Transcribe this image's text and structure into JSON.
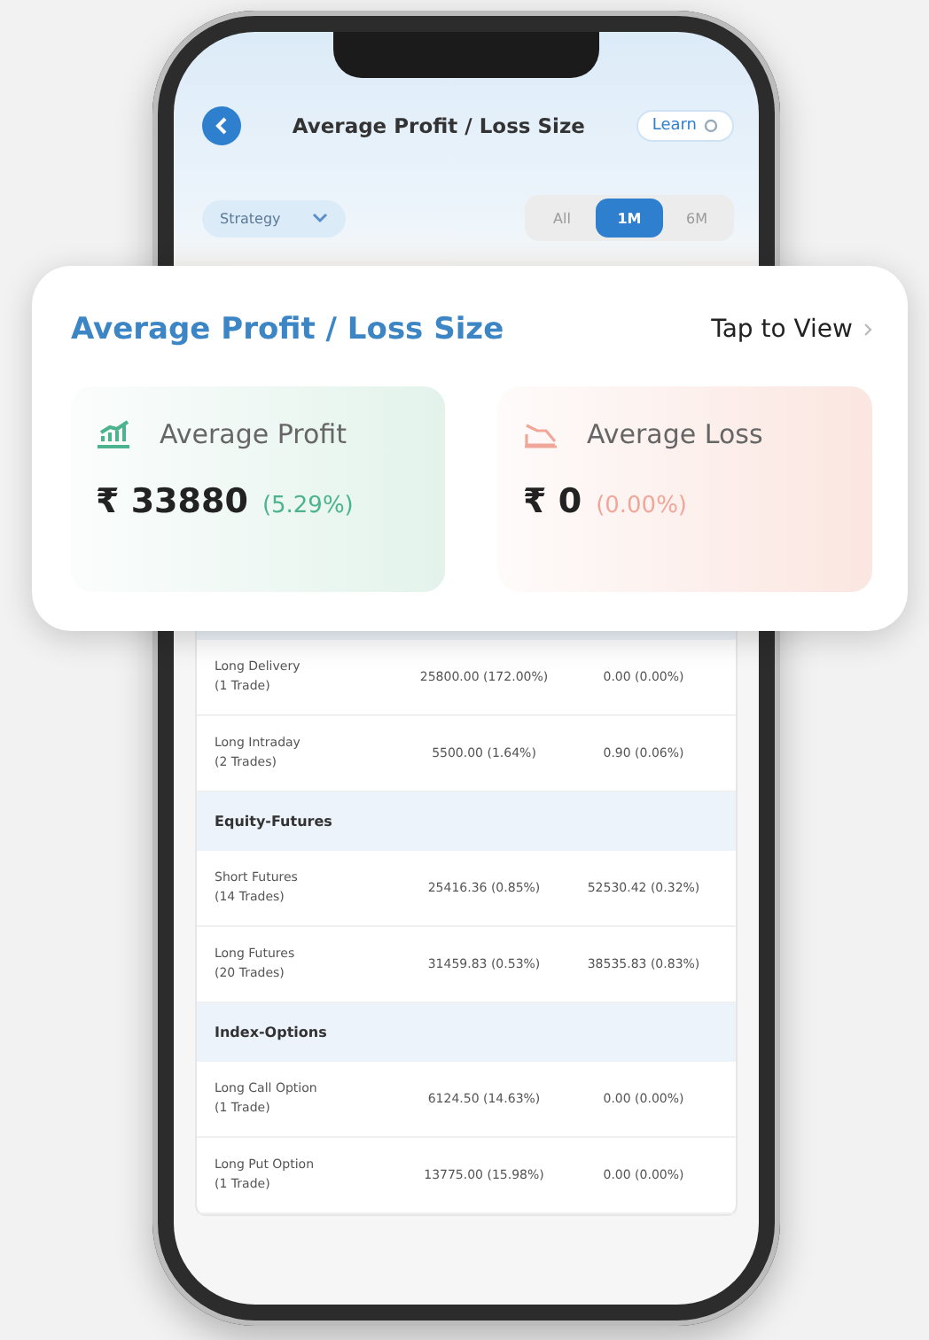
{
  "header": {
    "title": "Average Profit / Loss Size",
    "learn_button": "Learn"
  },
  "filters": {
    "dropdown": "Strategy",
    "periods": [
      {
        "label": "All",
        "selected": false
      },
      {
        "label": "1M",
        "selected": true
      },
      {
        "label": "6M",
        "selected": false
      }
    ]
  },
  "summary_card": {
    "title": "Average Profit / Loss Size",
    "link": "Tap to View",
    "tiles": [
      {
        "kind": "profit",
        "label": "Average Profit",
        "amount": "₹ 33880",
        "percent": "(5.29%)"
      },
      {
        "kind": "loss",
        "label": "Average Loss",
        "amount": "₹ 0",
        "percent": "(0.00%)"
      }
    ]
  },
  "table": {
    "sections": [
      {
        "rows": [
          {
            "name": "Long Delivery",
            "trades": "(1 Trade)",
            "profit": "25800.00 (172.00%)",
            "loss": "0.00 (0.00%)"
          },
          {
            "name": "Long Intraday",
            "trades": "(2 Trades)",
            "profit": "5500.00 (1.64%)",
            "loss": "0.90 (0.06%)"
          }
        ]
      },
      {
        "title": "Equity-Futures",
        "rows": [
          {
            "name": "Short Futures",
            "trades": "(14 Trades)",
            "profit": "25416.36 (0.85%)",
            "loss": "52530.42 (0.32%)"
          },
          {
            "name": "Long Futures",
            "trades": "(20 Trades)",
            "profit": "31459.83 (0.53%)",
            "loss": "38535.83 (0.83%)"
          }
        ]
      },
      {
        "title": "Index-Options",
        "rows": [
          {
            "name": "Long Call Option",
            "trades": "(1 Trade)",
            "profit": "6124.50 (14.63%)",
            "loss": "0.00 (0.00%)"
          },
          {
            "name": "Long Put Option",
            "trades": "(1 Trade)",
            "profit": "13775.00 (15.98%)",
            "loss": "0.00 (0.00%)"
          }
        ]
      }
    ]
  }
}
